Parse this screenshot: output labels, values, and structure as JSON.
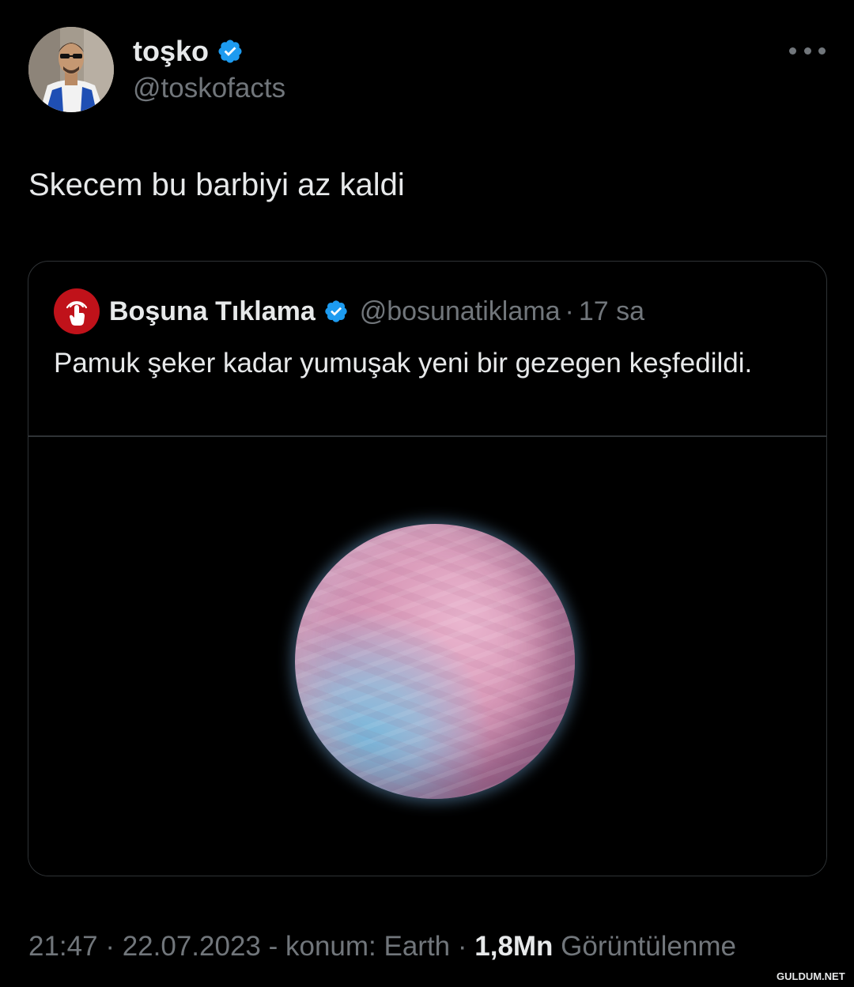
{
  "author": {
    "display_name": "toşko",
    "handle": "@toskofacts",
    "verified": true
  },
  "tweet": {
    "text": "Skecem bu barbiyi az kaldi"
  },
  "quoted_tweet": {
    "display_name": "Boşuna Tıklama",
    "handle": "@bosunatiklama",
    "separator": "·",
    "time_ago": "17 sa",
    "text": "Pamuk şeker kadar yumuşak yeni bir gezegen keşfedildi.",
    "verified": true
  },
  "meta": {
    "time": "21:47",
    "sep1": " · ",
    "date": "22.07.2023",
    "location": " - konum: Earth",
    "sep2": " · ",
    "views_count": "1,8Mn",
    "views_label": " Görüntülenme"
  },
  "watermark": "GULDUM.NET",
  "colors": {
    "background": "#000000",
    "text_primary": "#e7e9ea",
    "text_secondary": "#71767b",
    "verified_blue": "#1d9bf0",
    "border": "#2f3336",
    "quote_avatar_red": "#c0121a"
  },
  "icons": {
    "verified": "verified-badge-icon",
    "more": "more-horizontal-icon",
    "quote_avatar": "pointer-hand-icon"
  }
}
